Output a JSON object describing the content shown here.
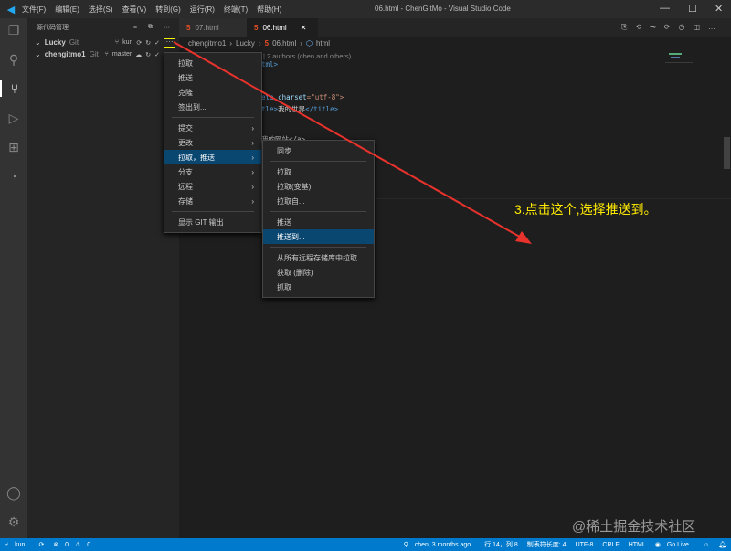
{
  "window": {
    "title": "06.html - ChenGitMo - Visual Studio Code",
    "menu": [
      "文件(F)",
      "编辑(E)",
      "选择(S)",
      "查看(V)",
      "转到(G)",
      "运行(R)",
      "终端(T)",
      "帮助(H)"
    ]
  },
  "sidebar": {
    "title": "源代码管理",
    "repos": [
      {
        "name": "Lucky",
        "type": "Git",
        "branch": "kun"
      },
      {
        "name": "chengitmo1",
        "type": "Git",
        "branch": "master"
      }
    ]
  },
  "tabs": [
    {
      "label": "07.html",
      "active": false
    },
    {
      "label": "06.html",
      "active": true
    }
  ],
  "breadcrumb": [
    "chengitmo1",
    "Lucky",
    "06.html",
    "html"
  ],
  "code": {
    "blame": "onds ago | 2 authors (chen and others)",
    "l1": "tml>",
    "l2a": "eta ",
    "l2b": "charset",
    "l2c": "=\"utf-8\">",
    "l3a": "tle>",
    "l3b": "我的世界",
    "l3c": "</title>",
    "l4": "我的网站</a>"
  },
  "menu": {
    "items": [
      "拉取",
      "推送",
      "克隆",
      "签出到...",
      "提交",
      "更改",
      "拉取，推送",
      "分支",
      "远程",
      "存储",
      "显示 GIT 输出"
    ]
  },
  "submenu": {
    "items": [
      "同步",
      "拉取",
      "拉取(变基)",
      "拉取自...",
      "推送",
      "推送到...",
      "从所有远程存储库中拉取",
      "获取 (删除)",
      "抓取"
    ]
  },
  "annotation": "3.点击这个,选择推送到。",
  "watermark": "@稀土掘金技术社区",
  "status": {
    "branch": "kun",
    "errors": "0",
    "warnings": "0",
    "blame": "chen, 3 months ago",
    "position": "行 14，列 8",
    "tab": "制表符长度: 4",
    "encoding": "UTF-8",
    "eol": "CRLF",
    "lang": "HTML",
    "golive": "Go Live"
  }
}
